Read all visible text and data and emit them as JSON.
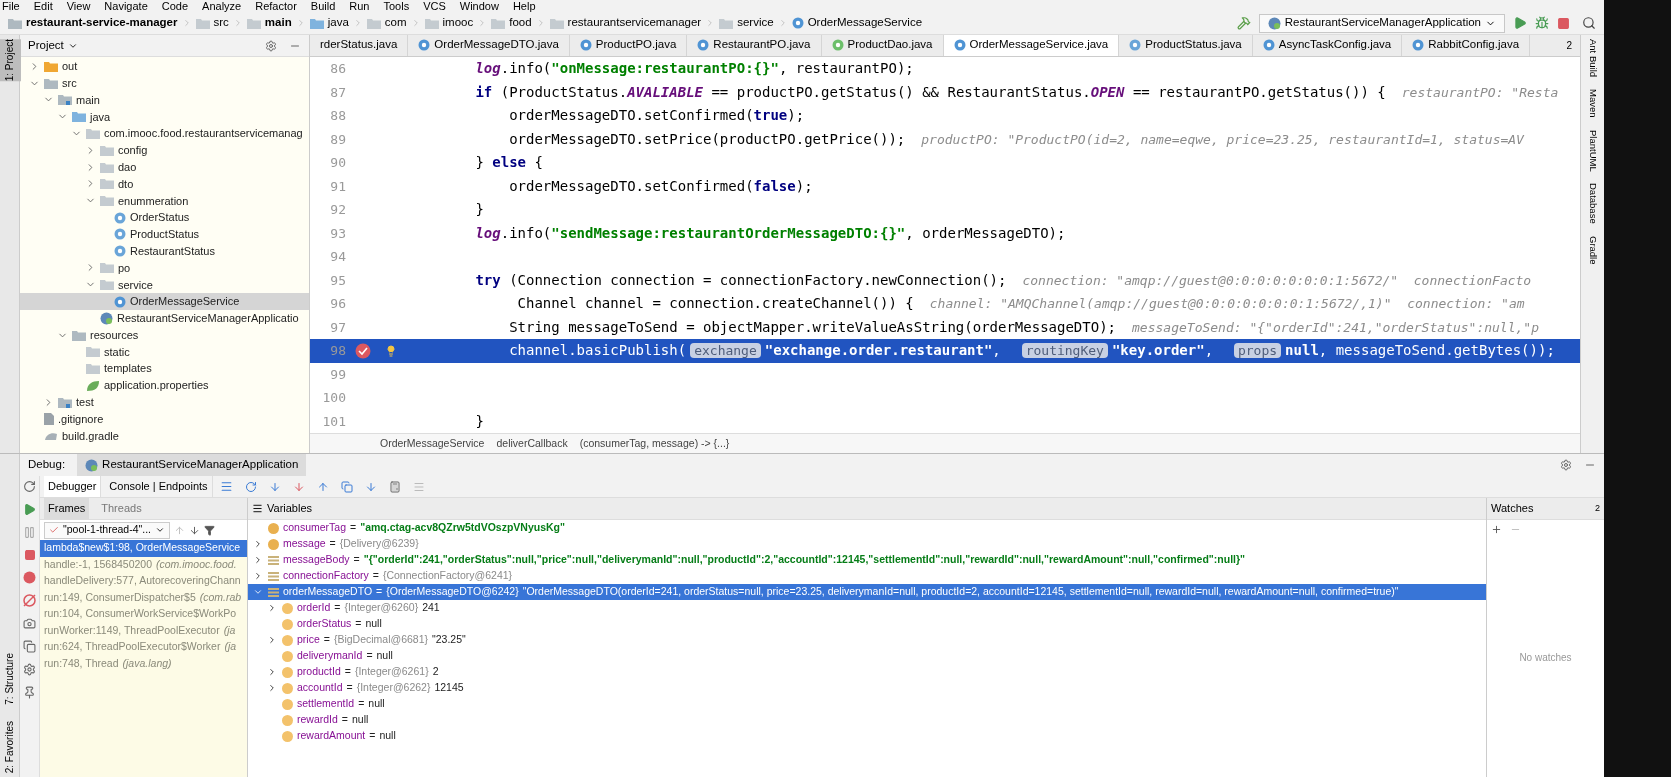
{
  "menu": [
    "File",
    "Edit",
    "View",
    "Navigate",
    "Code",
    "Analyze",
    "Refactor",
    "Build",
    "Run",
    "Tools",
    "VCS",
    "Window",
    "Help"
  ],
  "navbar": {
    "path": [
      {
        "text": "restaurant-service-manager",
        "kind": "module"
      },
      {
        "text": "src",
        "kind": "folder"
      },
      {
        "text": "main",
        "kind": "source"
      },
      {
        "text": "java",
        "kind": "source"
      },
      {
        "text": "com",
        "kind": "package"
      },
      {
        "text": "imooc",
        "kind": "package"
      },
      {
        "text": "food",
        "kind": "package"
      },
      {
        "text": "restaurantservicemanager",
        "kind": "package"
      },
      {
        "text": "service",
        "kind": "package"
      },
      {
        "text": "OrderMessageService",
        "kind": "class"
      }
    ],
    "run_configuration": "RestaurantServiceManagerApplication"
  },
  "left_stripe": [
    {
      "label": "1: Project",
      "selected": true
    },
    {
      "label": "7: Structure",
      "selected": false
    },
    {
      "label": "2: Favorites",
      "selected": false
    }
  ],
  "project_panel": {
    "title": "Project",
    "tree": [
      {
        "label": "out",
        "kind": "excluded",
        "expanded": false,
        "selected": false
      },
      {
        "label": "src",
        "kind": "folder",
        "expanded": true,
        "selected": false,
        "children": [
          {
            "label": "main",
            "kind": "source",
            "expanded": true,
            "selected": false,
            "children": [
              {
                "label": "java",
                "kind": "source-root",
                "expanded": true,
                "selected": false,
                "children": [
                  {
                    "label": "com.imooc.food.restaurantservicemanag",
                    "kind": "package",
                    "expanded": true,
                    "selected": false,
                    "children": [
                      {
                        "label": "config",
                        "kind": "package",
                        "expanded": false,
                        "selected": false
                      },
                      {
                        "label": "dao",
                        "kind": "package",
                        "expanded": false,
                        "selected": false
                      },
                      {
                        "label": "dto",
                        "kind": "package",
                        "expanded": false,
                        "selected": false
                      },
                      {
                        "label": "enummeration",
                        "kind": "package",
                        "expanded": true,
                        "selected": false,
                        "children": [
                          {
                            "label": "OrderStatus",
                            "kind": "enum",
                            "selected": false
                          },
                          {
                            "label": "ProductStatus",
                            "kind": "enum",
                            "selected": false
                          },
                          {
                            "label": "RestaurantStatus",
                            "kind": "enum",
                            "selected": false
                          }
                        ]
                      },
                      {
                        "label": "po",
                        "kind": "package",
                        "expanded": false,
                        "selected": false
                      },
                      {
                        "label": "service",
                        "kind": "package",
                        "expanded": true,
                        "selected": false,
                        "children": [
                          {
                            "label": "OrderMessageService",
                            "kind": "class",
                            "selected": true
                          }
                        ]
                      },
                      {
                        "label": "RestaurantServiceManagerApplicatio",
                        "kind": "app",
                        "selected": false
                      }
                    ]
                  }
                ]
              },
              {
                "label": "resources",
                "kind": "resources",
                "expanded": true,
                "selected": false,
                "children": [
                  {
                    "label": "static",
                    "kind": "package",
                    "selected": false
                  },
                  {
                    "label": "templates",
                    "kind": "package",
                    "selected": false
                  },
                  {
                    "label": "application.properties",
                    "kind": "properties",
                    "selected": false
                  }
                ]
              }
            ]
          },
          {
            "label": "test",
            "kind": "source",
            "expanded": false,
            "selected": false
          }
        ]
      },
      {
        "label": ".gitignore",
        "kind": "file",
        "selected": false
      },
      {
        "label": "build.gradle",
        "kind": "gradle",
        "selected": false
      }
    ]
  },
  "editor": {
    "tabs": [
      {
        "label": "rderStatus.java",
        "kind": "none",
        "selected": false
      },
      {
        "label": "OrderMessageDTO.java",
        "kind": "class",
        "selected": false
      },
      {
        "label": "ProductPO.java",
        "kind": "class",
        "selected": false
      },
      {
        "label": "RestaurantPO.java",
        "kind": "class",
        "selected": false
      },
      {
        "label": "ProductDao.java",
        "kind": "interface",
        "selected": false
      },
      {
        "label": "OrderMessageService.java",
        "kind": "class",
        "selected": true
      },
      {
        "label": "ProductStatus.java",
        "kind": "enum",
        "selected": false
      },
      {
        "label": "AsyncTaskConfig.java",
        "kind": "class",
        "selected": false
      },
      {
        "label": "RabbitConfig.java",
        "kind": "class",
        "selected": false
      }
    ],
    "tab_overflow_count": "2",
    "lines": [
      {
        "number": "86",
        "current": false,
        "breakpoint": false,
        "segments": [
          {
            "kind": "static",
            "text": "        log"
          },
          {
            "kind": "plain",
            "text": ".info("
          },
          {
            "kind": "string",
            "text": "\"onMessage:restaurantPO:{}\""
          },
          {
            "kind": "plain",
            "text": ", restaurantPO);"
          }
        ]
      },
      {
        "number": "87",
        "current": false,
        "breakpoint": false,
        "segments": [
          {
            "kind": "keyword",
            "text": "        if"
          },
          {
            "kind": "plain",
            "text": " (ProductStatus."
          },
          {
            "kind": "static",
            "text": "AVALIABLE"
          },
          {
            "kind": "plain",
            "text": " == productPO.getStatus() && RestaurantStatus."
          },
          {
            "kind": "static",
            "text": "OPEN"
          },
          {
            "kind": "plain",
            "text": " == restaurantPO.getStatus()) {"
          },
          {
            "kind": "hint",
            "text": "restaurantPO: \"Resta"
          }
        ]
      },
      {
        "number": "88",
        "current": false,
        "breakpoint": false,
        "segments": [
          {
            "kind": "plain",
            "text": "            orderMessageDTO.setConfirmed("
          },
          {
            "kind": "keyword",
            "text": "true"
          },
          {
            "kind": "plain",
            "text": ");"
          }
        ]
      },
      {
        "number": "89",
        "current": false,
        "breakpoint": false,
        "segments": [
          {
            "kind": "plain",
            "text": "            orderMessageDTO.setPrice(productPO.getPrice());"
          },
          {
            "kind": "hint",
            "text": "productPO: \"ProductPO(id=2, name=eqwe, price=23.25, restaurantId=1, status=AV"
          }
        ]
      },
      {
        "number": "90",
        "current": false,
        "breakpoint": false,
        "segments": [
          {
            "kind": "plain",
            "text": "        } "
          },
          {
            "kind": "keyword",
            "text": "else"
          },
          {
            "kind": "plain",
            "text": " {"
          }
        ]
      },
      {
        "number": "91",
        "current": false,
        "breakpoint": false,
        "segments": [
          {
            "kind": "plain",
            "text": "            orderMessageDTO.setConfirmed("
          },
          {
            "kind": "keyword",
            "text": "false"
          },
          {
            "kind": "plain",
            "text": ");"
          }
        ]
      },
      {
        "number": "92",
        "current": false,
        "breakpoint": false,
        "segments": [
          {
            "kind": "plain",
            "text": "        }"
          }
        ]
      },
      {
        "number": "93",
        "current": false,
        "breakpoint": false,
        "segments": [
          {
            "kind": "static",
            "text": "        log"
          },
          {
            "kind": "plain",
            "text": ".info("
          },
          {
            "kind": "string",
            "text": "\"sendMessage:restaurantOrderMessageDTO:{}\""
          },
          {
            "kind": "plain",
            "text": ", orderMessageDTO);"
          }
        ]
      },
      {
        "number": "94",
        "current": false,
        "breakpoint": false
      },
      {
        "number": "95",
        "current": false,
        "breakpoint": false,
        "segments": [
          {
            "kind": "keyword",
            "text": "        try"
          },
          {
            "kind": "plain",
            "text": " (Connection connection = connectionFactory.newConnection();"
          },
          {
            "kind": "hint",
            "text": "connection: \"amqp://guest@0:0:0:0:0:0:0:1:5672/\"  connectionFacto"
          }
        ]
      },
      {
        "number": "96",
        "current": false,
        "breakpoint": false,
        "segments": [
          {
            "kind": "plain",
            "text": "             Channel channel = connection.createChannel()) {"
          },
          {
            "kind": "hint",
            "text": "channel: \"AMQChannel(amqp://guest@0:0:0:0:0:0:0:1:5672/,1)\"  connection: \"am"
          }
        ]
      },
      {
        "number": "97",
        "current": false,
        "breakpoint": false,
        "segments": [
          {
            "kind": "plain",
            "text": "            String messageToSend = objectMapper.writeValueAsString(orderMessageDTO);"
          },
          {
            "kind": "hint",
            "text": "messageToSend: \"{\"orderId\":241,\"orderStatus\":null,\"p"
          }
        ]
      },
      {
        "number": "98",
        "current": true,
        "breakpoint": true,
        "segments": [
          {
            "kind": "plain",
            "text": "            channel.basicPublish("
          },
          {
            "kind": "param",
            "text": "exchange"
          },
          {
            "kind": "string",
            "text": "\"exchange.order.restaurant\""
          },
          {
            "kind": "plain",
            "text": ",  "
          },
          {
            "kind": "param",
            "text": "routingKey"
          },
          {
            "kind": "string",
            "text": "\"key.order\""
          },
          {
            "kind": "plain",
            "text": ",  "
          },
          {
            "kind": "param",
            "text": "props"
          },
          {
            "kind": "keyword",
            "text": "null"
          },
          {
            "kind": "plain",
            "text": ", messageToSend.getBytes());"
          }
        ]
      },
      {
        "number": "99",
        "current": false,
        "breakpoint": false
      },
      {
        "number": "100",
        "current": false,
        "breakpoint": false
      },
      {
        "number": "101",
        "current": false,
        "breakpoint": false,
        "segments": [
          {
            "kind": "plain",
            "text": "        }"
          }
        ]
      }
    ],
    "breadcrumb": [
      "OrderMessageService",
      "deliverCallback",
      "(consumerTag, message) -> {...}"
    ]
  },
  "right_stripe": [
    "Ant Build",
    "Maven",
    "PlantUML",
    "Database",
    "Gradle"
  ],
  "debug": {
    "title": "Debug:",
    "session": "RestaurantServiceManagerApplication",
    "tabs": [
      {
        "label": "Debugger",
        "selected": true
      },
      {
        "label": "Console | Endpoints",
        "selected": false
      }
    ],
    "frames_tabs": [
      {
        "label": "Frames",
        "selected": true
      },
      {
        "label": "Threads",
        "selected": false
      }
    ],
    "thread": "\"pool-1-thread-4\"...",
    "frames": [
      {
        "text": "lambda$new$1:98, OrderMessageService",
        "selected": true
      },
      {
        "text": "handle:-1, 1568450200",
        "detail": "(com.imooc.food.",
        "selected": false
      },
      {
        "text": "handleDelivery:577, AutorecoveringChann",
        "selected": false
      },
      {
        "text": "run:149, ConsumerDispatcher$5",
        "detail": "(com.rab",
        "selected": false
      },
      {
        "text": "run:104, ConsumerWorkService$WorkPo",
        "selected": false
      },
      {
        "text": "runWorker:1149, ThreadPoolExecutor",
        "detail": "(ja",
        "selected": false
      },
      {
        "text": "run:624, ThreadPoolExecutor$Worker",
        "detail": "(ja",
        "selected": false
      },
      {
        "text": "run:748, Thread",
        "detail": "(java.lang)",
        "selected": false
      }
    ],
    "variables_title": "Variables",
    "variables": [
      {
        "name": "consumerTag",
        "operator": "=",
        "kind": "param",
        "selected": false,
        "value": "\"amq.ctag-acv8QZrw5tdVOszpVNyusKg\"",
        "bold": true
      },
      {
        "name": "message",
        "operator": "=",
        "kind": "param",
        "expanded": false,
        "selected": false,
        "type": "{Delivery@6239}"
      },
      {
        "name": "messageBody",
        "operator": "=",
        "kind": "local",
        "expanded": false,
        "selected": false,
        "value": "\"{\"orderId\":241,\"orderStatus\":null,\"price\":null,\"deliverymanId\":null,\"productId\":2,\"accountId\":12145,\"settlementId\":null,\"rewardId\":null,\"rewardAmount\":null,\"confirmed\":null}\"",
        "bold": true
      },
      {
        "name": "connectionFactory",
        "operator": "=",
        "kind": "local",
        "expanded": false,
        "selected": false,
        "type": "{ConnectionFactory@6241}"
      },
      {
        "name": "orderMessageDTO",
        "operator": "=",
        "kind": "local",
        "expanded": true,
        "selected": true,
        "type": "{OrderMessageDTO@6242}",
        "value": "\"OrderMessageDTO(orderId=241, orderStatus=null, price=23.25, deliverymanId=null, productId=2, accountId=12145, settlementId=null, rewardId=null, rewardAmount=null, confirmed=true)\"",
        "bold": false,
        "children": [
          {
            "name": "orderId",
            "operator": "=",
            "kind": "field",
            "expanded": false,
            "selected": false,
            "type": "{Integer@6260}",
            "value": "241",
            "bold": false
          },
          {
            "name": "orderStatus",
            "operator": "=",
            "kind": "field",
            "selected": false,
            "value": "null",
            "bold": false
          },
          {
            "name": "price",
            "operator": "=",
            "kind": "field",
            "expanded": false,
            "selected": false,
            "type": "{BigDecimal@6681}",
            "value": "\"23.25\"",
            "bold": false
          },
          {
            "name": "deliverymanId",
            "operator": "=",
            "kind": "field",
            "selected": false,
            "value": "null",
            "bold": false
          },
          {
            "name": "productId",
            "operator": "=",
            "kind": "field",
            "expanded": false,
            "selected": false,
            "type": "{Integer@6261}",
            "value": "2",
            "bold": false
          },
          {
            "name": "accountId",
            "operator": "=",
            "kind": "field",
            "expanded": false,
            "selected": false,
            "type": "{Integer@6262}",
            "value": "12145",
            "bold": false
          },
          {
            "name": "settlementId",
            "operator": "=",
            "kind": "field",
            "selected": false,
            "value": "null",
            "bold": false
          },
          {
            "name": "rewardId",
            "operator": "=",
            "kind": "field",
            "selected": false,
            "value": "null",
            "bold": false
          },
          {
            "name": "rewardAmount",
            "operator": "=",
            "kind": "field",
            "selected": false,
            "value": "null",
            "bold": false
          }
        ]
      }
    ],
    "watches_title": "Watches",
    "watches_empty": "No watches",
    "watches_count": "2"
  }
}
